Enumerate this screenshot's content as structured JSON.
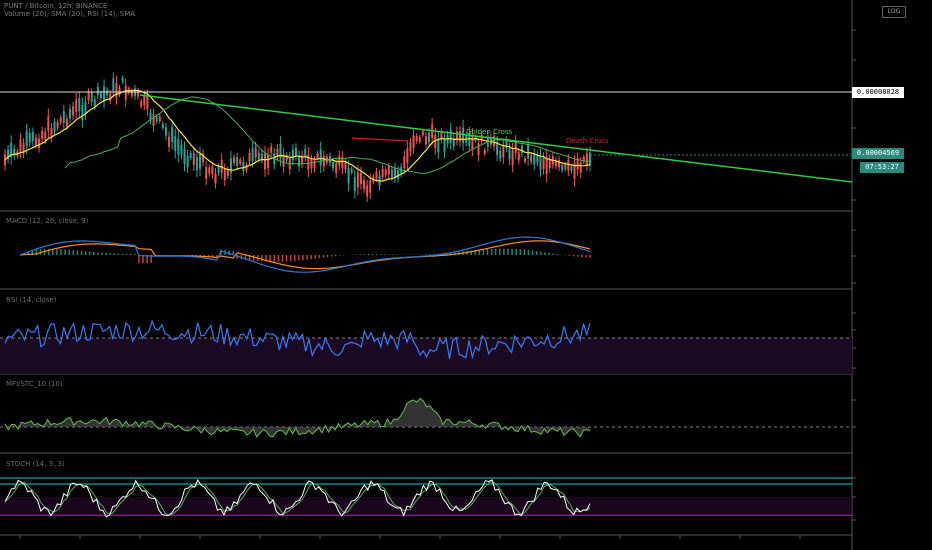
{
  "header": {
    "line1": "PUNT / Bitcoin, 12h, BINANCE",
    "line2": "Volume (20), SMA (20), RSI (14), SMA"
  },
  "scale_button": "LOG",
  "price_tags": {
    "hline_price": "0.00008028",
    "last_price": "0.00004569",
    "countdown": "07:53:27"
  },
  "annotations": {
    "golden_cross": "Golden Cross",
    "death_cross": "Death Cross"
  },
  "pane_labels": {
    "macd": "MACD (12, 26, close, 9)",
    "rsi": "RSI (14, close)",
    "cmf": "MFI/STC_10 (10)",
    "stoch": "STOCH (14, 3, 3)"
  },
  "colors": {
    "background": "#000000",
    "trendline": "#2ecc40",
    "ma_fast": "#f5e642",
    "ma_slow": "#4caf50",
    "macd_line": "#2a7ad5",
    "signal_line": "#ff8c1a",
    "rsi_line": "#3b7bf0",
    "rsi_fill": "#1b0a24",
    "stoch_k": "#ffffff",
    "stoch_bands": "#1ec8c8",
    "stoch_low_band": "#d020d0",
    "death_cross_line": "#d22020",
    "up_candle": "#26a69a",
    "down_candle": "#ef5350"
  }
}
